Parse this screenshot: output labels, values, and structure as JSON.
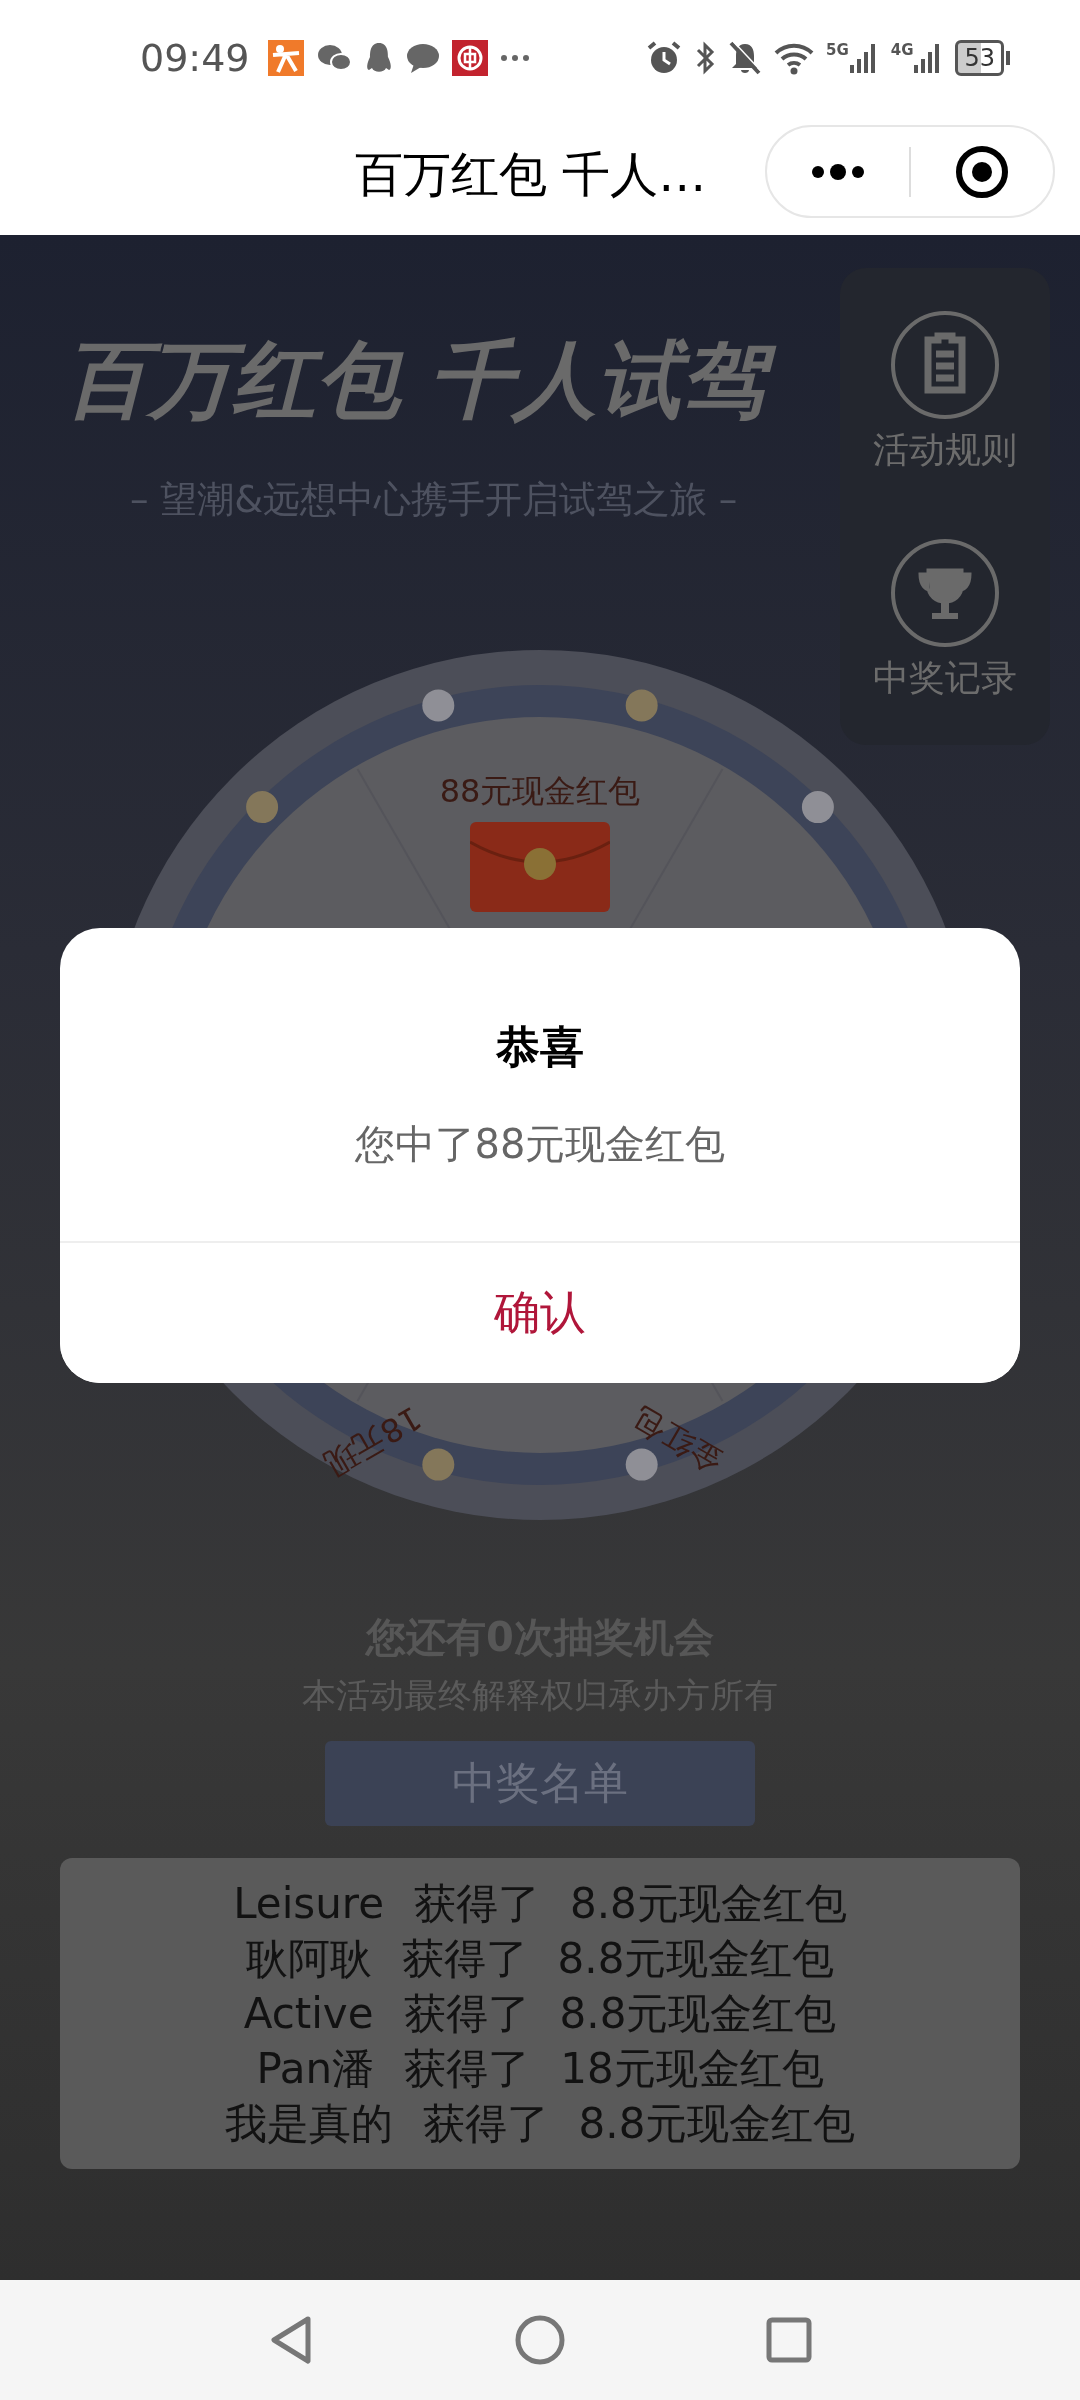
{
  "status_bar": {
    "time": "09:49",
    "network_1": "5G",
    "network_2": "4G",
    "battery": "53"
  },
  "header": {
    "title": "百万红包 千人…"
  },
  "banner": {
    "title": "百万红包 千人试驾",
    "subtitle": "– 望潮&远想中心携手开启试驾之旅 –"
  },
  "side_menu": [
    {
      "label": "活动规则",
      "kind": "clipboard"
    },
    {
      "label": "中奖记录",
      "kind": "trophy"
    }
  ],
  "wheel": {
    "segments": [
      {
        "label": "88元现金红包",
        "kind": "top"
      },
      {
        "label": "18元现",
        "kind": "lowerleft"
      },
      {
        "label": "金红包",
        "kind": "lowerright"
      }
    ]
  },
  "draw_info": {
    "chances": "您还有0次抽奖机会",
    "notice": "本活动最终解释权归承办方所有",
    "button": "中奖名单"
  },
  "winners": [
    {
      "name": "Leisure",
      "action": "获得了",
      "prize": "8.8元现金红包"
    },
    {
      "name": "耿阿耿",
      "action": "获得了",
      "prize": "8.8元现金红包"
    },
    {
      "name": "Active",
      "action": "获得了",
      "prize": "8.8元现金红包"
    },
    {
      "name": "Pan潘",
      "action": "获得了",
      "prize": "18元现金红包"
    },
    {
      "name": "我是真的",
      "action": "获得了",
      "prize": "8.8元现金红包"
    }
  ],
  "dialog": {
    "title": "恭喜",
    "message": "您中了88元现金红包",
    "confirm": "确认"
  }
}
